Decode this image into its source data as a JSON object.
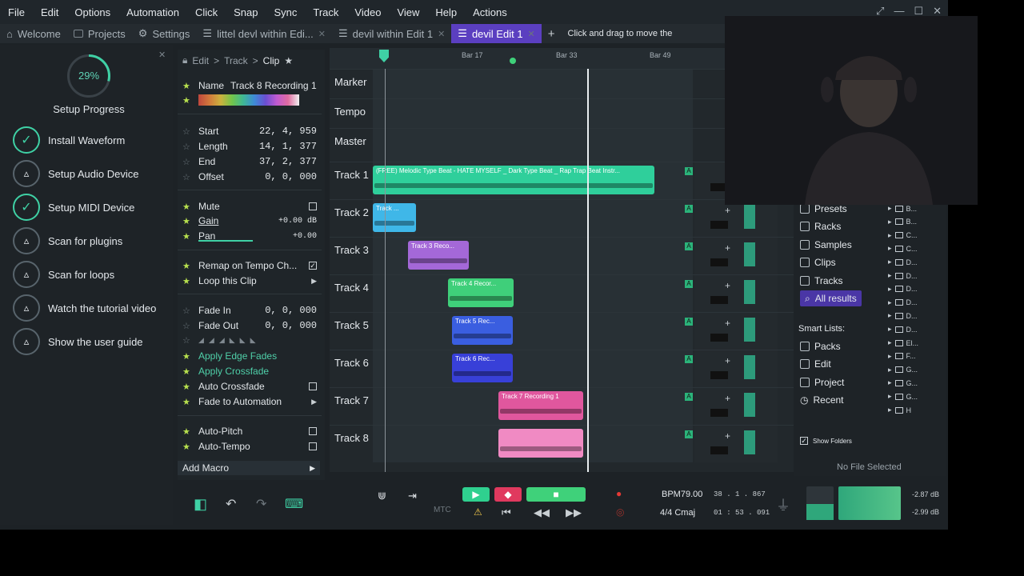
{
  "menu": [
    "File",
    "Edit",
    "Options",
    "Automation",
    "Click",
    "Snap",
    "Sync",
    "Track",
    "Video",
    "View",
    "Help",
    "Actions"
  ],
  "tabs": [
    {
      "label": "Welcome",
      "active": false
    },
    {
      "label": "Projects",
      "active": false
    },
    {
      "label": "Settings",
      "active": false
    },
    {
      "label": "littel devl within Edi...",
      "active": false
    },
    {
      "label": "devil within Edit 1",
      "active": false
    },
    {
      "label": "devil Edit 1",
      "active": true
    }
  ],
  "hint": "Click and drag to move the",
  "setup": {
    "percent": "29%",
    "progress": 0.29,
    "title": "Setup Progress",
    "items": [
      {
        "label": "Install Waveform",
        "done": true
      },
      {
        "label": "Setup Audio Device",
        "done": false
      },
      {
        "label": "Setup MIDI Device",
        "done": true
      },
      {
        "label": "Scan for plugins",
        "done": false
      },
      {
        "label": "Scan for loops",
        "done": false
      },
      {
        "label": "Watch the tutorial video",
        "done": false
      },
      {
        "label": "Show the user guide",
        "done": false
      }
    ]
  },
  "inspector": {
    "breadcrumb": [
      "Edit",
      "Track",
      "Clip"
    ],
    "name_label": "Name",
    "name_value": "Track 8 Recording 1",
    "start_label": "Start",
    "start_value": "22, 4, 959",
    "length_label": "Length",
    "length_value": "14, 1, 377",
    "end_label": "End",
    "end_value": "37, 2, 377",
    "offset_label": "Offset",
    "offset_value": "0, 0, 000",
    "mute_label": "Mute",
    "gain_label": "Gain",
    "gain_value": "+0.00 dB",
    "pan_label": "Pan",
    "pan_value": "+0.00",
    "remap_label": "Remap on Tempo Ch...",
    "loop_label": "Loop this Clip",
    "fadein_label": "Fade In",
    "fadein_value": "0, 0, 000",
    "fadeout_label": "Fade Out",
    "fadeout_value": "0, 0, 000",
    "edge_fades": "Apply Edge Fades",
    "crossfade": "Apply Crossfade",
    "auto_crossfade": "Auto Crossfade",
    "fade_auto": "Fade to Automation",
    "autopitch": "Auto-Pitch",
    "autotempo": "Auto-Tempo",
    "add_macro": "Add Macro"
  },
  "ruler": {
    "bars": [
      "Bar 17",
      "Bar 33",
      "Bar 49"
    ]
  },
  "tracks": [
    {
      "name": "Marker"
    },
    {
      "name": "Tempo"
    },
    {
      "name": "Master"
    },
    {
      "name": "Track 1",
      "clip": "(FREE) Melodic Type Beat - HATE MYSELF _ Dark Type Beat _ Rap Trap Beat Instr...",
      "color": "#2fcf9b"
    },
    {
      "name": "Track 2",
      "clip": "Track ...",
      "color": "#3fb7e8"
    },
    {
      "name": "Track 3",
      "clip": "Track 3 Reco...",
      "color": "#a468d8"
    },
    {
      "name": "Track 4",
      "clip": "Track 4 Recor...",
      "color": "#3fcf7a"
    },
    {
      "name": "Track 5",
      "clip": "Track 5 Rec...",
      "color": "#3a5ee0"
    },
    {
      "name": "Track 6",
      "clip": "Track 6 Rec...",
      "color": "#3840d8"
    },
    {
      "name": "Track 7",
      "clip": "Track 7 Recording 1",
      "color": "#e0579e"
    },
    {
      "name": "Track 8",
      "clip": "",
      "color": "#f08ac3"
    }
  ],
  "browser": {
    "items": [
      "Presets",
      "Racks",
      "Samples",
      "Clips",
      "Tracks",
      "All results"
    ],
    "smart_title": "Smart Lists:",
    "smart": [
      "Packs",
      "Edit",
      "Project",
      "Recent"
    ],
    "show_folders": "Show Folders",
    "no_file": "No File Selected",
    "tree": [
      "B...",
      "B...",
      "C...",
      "C...",
      "D...",
      "D...",
      "D...",
      "D...",
      "D...",
      "D...",
      "El...",
      "F...",
      "G...",
      "G...",
      "G...",
      "H"
    ]
  },
  "transport": {
    "bpm": "BPM79.00",
    "position": "38 . 1 . 867",
    "signature": "4/4  Cmaj",
    "clock": "01 : 53 . 091",
    "db_top": "-2.87 dB",
    "db_bottom": "-2.99 dB",
    "mtc": "MTC"
  },
  "colors": {
    "accent": "#5b3fc0",
    "green": "#3fd1a5"
  }
}
